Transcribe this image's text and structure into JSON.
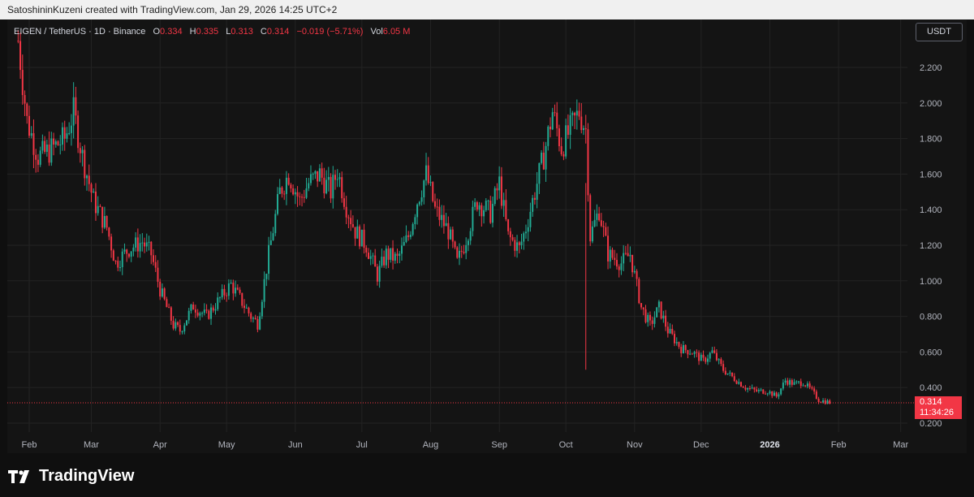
{
  "header": {
    "credit": "SatoshininKuzeni created with TradingView.com, Jan 29, 2026 14:25 UTC+2"
  },
  "legend": {
    "symbol": "EIGEN / TetherUS · 1D · Binance",
    "o_label": "O",
    "o_value": "0.334",
    "h_label": "H",
    "h_value": "0.335",
    "l_label": "L",
    "l_value": "0.313",
    "c_label": "C",
    "c_value": "0.314",
    "change": "−0.019 (−5.71%)",
    "vol_label": "Vol",
    "vol_value": "6.05 M"
  },
  "currency_button": "USDT",
  "last_price": {
    "value": "0.314",
    "countdown": "11:34:26"
  },
  "footer": {
    "brand": "TradingView"
  },
  "colors": {
    "up": "#22ab94",
    "down": "#f23645",
    "grid": "#232323",
    "axis_text": "#b2b5be"
  },
  "chart_data": {
    "type": "candlestick",
    "title": "EIGEN / TetherUS · 1D · Binance",
    "ylim": [
      0.14,
      2.44
    ],
    "y_ticks": [
      "2.200",
      "2.000",
      "1.800",
      "1.600",
      "1.400",
      "1.200",
      "1.000",
      "0.800",
      "0.600",
      "0.400",
      "0.200"
    ],
    "x_ticks": [
      "Feb",
      "Mar",
      "Apr",
      "May",
      "Jun",
      "Jul",
      "Aug",
      "Sep",
      "Oct",
      "Nov",
      "Dec",
      "2026",
      "Feb",
      "Mar"
    ],
    "x_tick_bold": "2026",
    "last_close": 0.314,
    "close_path": [
      [
        "2025-01-27",
        2.35
      ],
      [
        "2025-01-31",
        1.9
      ],
      [
        "2025-02-05",
        1.7
      ],
      [
        "2025-02-10",
        1.73
      ],
      [
        "2025-02-17",
        1.8
      ],
      [
        "2025-02-21",
        1.95
      ],
      [
        "2025-02-25",
        1.7
      ],
      [
        "2025-03-02",
        1.45
      ],
      [
        "2025-03-08",
        1.3
      ],
      [
        "2025-03-12",
        1.1
      ],
      [
        "2025-03-18",
        1.18
      ],
      [
        "2025-03-24",
        1.22
      ],
      [
        "2025-03-28",
        1.15
      ],
      [
        "2025-04-01",
        0.95
      ],
      [
        "2025-04-07",
        0.75
      ],
      [
        "2025-04-10",
        0.72
      ],
      [
        "2025-04-16",
        0.86
      ],
      [
        "2025-04-22",
        0.8
      ],
      [
        "2025-04-28",
        0.9
      ],
      [
        "2025-05-03",
        0.98
      ],
      [
        "2025-05-08",
        0.88
      ],
      [
        "2025-05-12",
        0.8
      ],
      [
        "2025-05-15",
        0.76
      ],
      [
        "2025-05-20",
        1.15
      ],
      [
        "2025-05-25",
        1.5
      ],
      [
        "2025-05-29",
        1.6
      ],
      [
        "2025-06-03",
        1.45
      ],
      [
        "2025-06-07",
        1.55
      ],
      [
        "2025-06-12",
        1.6
      ],
      [
        "2025-06-17",
        1.5
      ],
      [
        "2025-06-20",
        1.62
      ],
      [
        "2025-06-24",
        1.42
      ],
      [
        "2025-06-28",
        1.28
      ],
      [
        "2025-07-03",
        1.2
      ],
      [
        "2025-07-08",
        1.03
      ],
      [
        "2025-07-12",
        1.15
      ],
      [
        "2025-07-17",
        1.12
      ],
      [
        "2025-07-22",
        1.25
      ],
      [
        "2025-07-26",
        1.45
      ],
      [
        "2025-07-30",
        1.6
      ],
      [
        "2025-08-03",
        1.4
      ],
      [
        "2025-08-09",
        1.28
      ],
      [
        "2025-08-13",
        1.1
      ],
      [
        "2025-08-16",
        1.2
      ],
      [
        "2025-08-22",
        1.45
      ],
      [
        "2025-08-28",
        1.38
      ],
      [
        "2025-09-01",
        1.55
      ],
      [
        "2025-09-05",
        1.25
      ],
      [
        "2025-09-10",
        1.18
      ],
      [
        "2025-09-13",
        1.3
      ],
      [
        "2025-09-17",
        1.5
      ],
      [
        "2025-09-21",
        1.7
      ],
      [
        "2025-09-25",
        1.95
      ],
      [
        "2025-09-29",
        1.75
      ],
      [
        "2025-10-03",
        1.85
      ],
      [
        "2025-10-07",
        1.95
      ],
      [
        "2025-10-10",
        1.85
      ],
      [
        "2025-10-12",
        1.25
      ],
      [
        "2025-10-16",
        1.4
      ],
      [
        "2025-10-20",
        1.15
      ],
      [
        "2025-10-26",
        1.1
      ],
      [
        "2025-10-30",
        1.15
      ],
      [
        "2025-11-04",
        0.85
      ],
      [
        "2025-11-08",
        0.75
      ],
      [
        "2025-11-12",
        0.85
      ],
      [
        "2025-11-16",
        0.72
      ],
      [
        "2025-11-22",
        0.62
      ],
      [
        "2025-11-27",
        0.6
      ],
      [
        "2025-12-02",
        0.55
      ],
      [
        "2025-12-06",
        0.6
      ],
      [
        "2025-12-11",
        0.5
      ],
      [
        "2025-12-16",
        0.45
      ],
      [
        "2025-12-21",
        0.4
      ],
      [
        "2025-12-26",
        0.38
      ],
      [
        "2025-12-31",
        0.38
      ],
      [
        "2026-01-04",
        0.35
      ],
      [
        "2026-01-08",
        0.44
      ],
      [
        "2026-01-12",
        0.42
      ],
      [
        "2026-01-16",
        0.43
      ],
      [
        "2026-01-20",
        0.38
      ],
      [
        "2026-01-23",
        0.33
      ],
      [
        "2026-01-29",
        0.314
      ]
    ]
  }
}
